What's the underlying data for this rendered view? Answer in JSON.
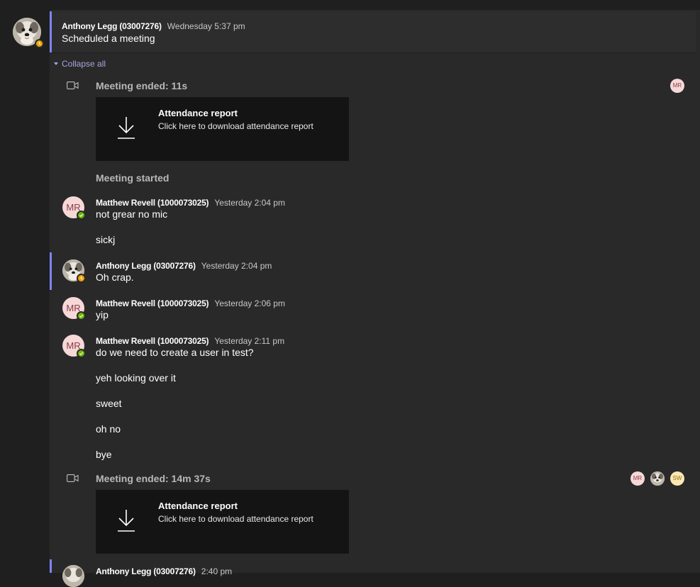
{
  "thread": {
    "header": {
      "author": "Anthony Legg (03007276)",
      "time": "Wednesday 5:37 pm",
      "text": "Scheduled a meeting"
    },
    "collapse_label": "Collapse all",
    "meeting1": {
      "label": "Meeting ended: 11s",
      "participants": [
        "MR"
      ],
      "card_title": "Attendance report",
      "card_sub": "Click here to download attendance report"
    },
    "meeting_started": "Meeting started",
    "messages": [
      {
        "author": "Matthew Revell (1000073025)",
        "time": "Yesterday 2:04 pm",
        "avatar": "MR",
        "lines": [
          "not grear no mic",
          "sickj"
        ]
      },
      {
        "author": "Anthony Legg (03007276)",
        "time": "Yesterday 2:04 pm",
        "lines": [
          "Oh crap."
        ]
      },
      {
        "author": "Matthew Revell (1000073025)",
        "time": "Yesterday 2:06 pm",
        "avatar": "MR",
        "lines": [
          "yip"
        ]
      },
      {
        "author": "Matthew Revell (1000073025)",
        "time": "Yesterday 2:11 pm",
        "avatar": "MR",
        "lines": [
          "do we need to create a user in test?",
          "yeh looking over it",
          "sweet",
          "oh no",
          "bye"
        ]
      }
    ],
    "meeting2": {
      "label": "Meeting ended: 14m 37s",
      "participants": [
        "MR",
        "SW"
      ],
      "card_title": "Attendance report",
      "card_sub": "Click here to download attendance report"
    },
    "next_post": {
      "author": "Anthony Legg (03007276)",
      "time": "2:40 pm"
    }
  },
  "icons": {
    "video": "video-camera-icon",
    "download": "download-icon",
    "away": "away-clock-icon",
    "available": "available-check-icon"
  },
  "colors": {
    "accent": "#7f85f5",
    "away": "#f0a30a",
    "available": "#6bb700",
    "link": "#a6a7dc"
  }
}
